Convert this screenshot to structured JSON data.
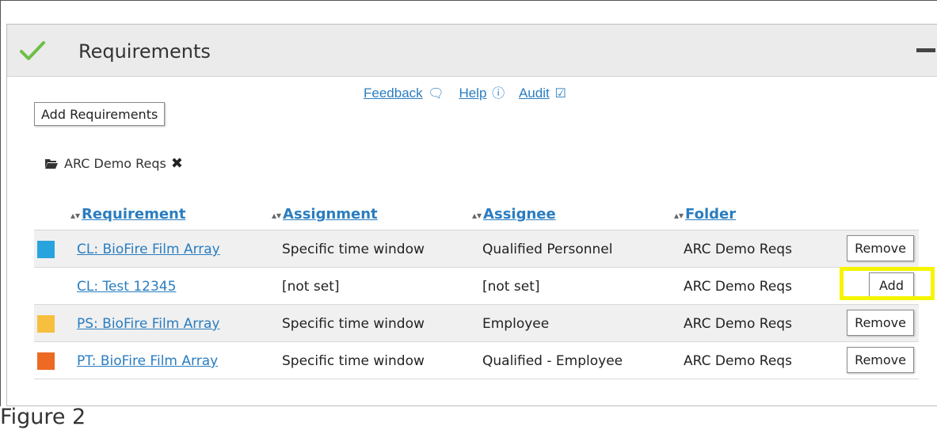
{
  "panel": {
    "title": "Requirements",
    "check_color": "#6cbf47",
    "links": [
      {
        "label": "Feedback",
        "icon": "comment-icon",
        "glyph": "❀"
      },
      {
        "label": "Help",
        "icon": "help-icon",
        "glyph": "①"
      },
      {
        "label": "Audit",
        "icon": "clipboard-check-icon",
        "glyph": "☑"
      }
    ],
    "add_button": "Add Requirements",
    "filter_label": "ARC Demo Reqs",
    "filter_remove_glyph": "✖"
  },
  "table": {
    "headers": [
      "Requirement",
      "Assignment",
      "Assignee",
      "Folder"
    ],
    "sort_glyph": "↕",
    "rows": [
      {
        "color": "#29a3dd",
        "requirement": "CL: BioFire Film Array",
        "assignment": "Specific time window",
        "assignee": "Qualified Personnel",
        "folder": "ARC Demo Reqs",
        "action": "Remove"
      },
      {
        "color": "",
        "requirement": "CL: Test 12345",
        "assignment": "[not set]",
        "assignee": "[not set]",
        "folder": "ARC Demo Reqs",
        "action": "Add"
      },
      {
        "color": "#f7bf3e",
        "requirement": "PS: BioFire Film Array",
        "assignment": "Specific time window",
        "assignee": "Employee",
        "folder": "ARC Demo Reqs",
        "action": "Remove"
      },
      {
        "color": "#ec6a24",
        "requirement": "PT: BioFire Film Array",
        "assignment": "Specific time window",
        "assignee": "Qualified - Employee",
        "folder": "ARC Demo Reqs",
        "action": "Remove"
      }
    ]
  },
  "highlight_color": "#f5f500",
  "caption": "Figure 2"
}
